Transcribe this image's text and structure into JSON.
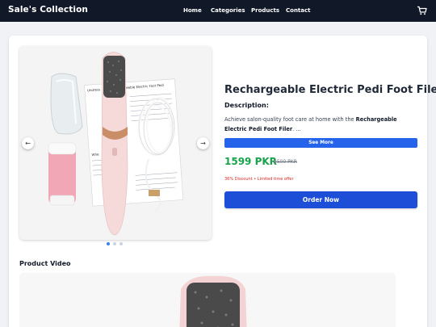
{
  "navbar": {
    "brand": "Sale's Collection",
    "links": [
      "Home",
      "Categories",
      "Products",
      "Contact"
    ],
    "cart_icon": "shopping-cart-icon"
  },
  "product": {
    "title": "Rechargeable Electric Pedi Foot Filer",
    "description_heading": "Description:",
    "description_prefix": "Achieve salon-quality foot care at home with the ",
    "description_bold": "Rechargeable Electric Pedi Foot Filer",
    "description_suffix": ". ...",
    "see_more_label": "See More",
    "price": "1599 PKR",
    "old_price": "2500 PKR",
    "discount_text": "36% Discount • Limited time offer",
    "order_label": "Order Now",
    "carousel": {
      "prev_label": "←",
      "next_label": "→",
      "slide_count": 3,
      "active_slide": 0,
      "manual_heading": "Rechargeable Electric Foot Pedi",
      "manual_lines": [
        "Undress",
        "Whe"
      ]
    }
  },
  "video_section": {
    "heading": "Product Video"
  }
}
